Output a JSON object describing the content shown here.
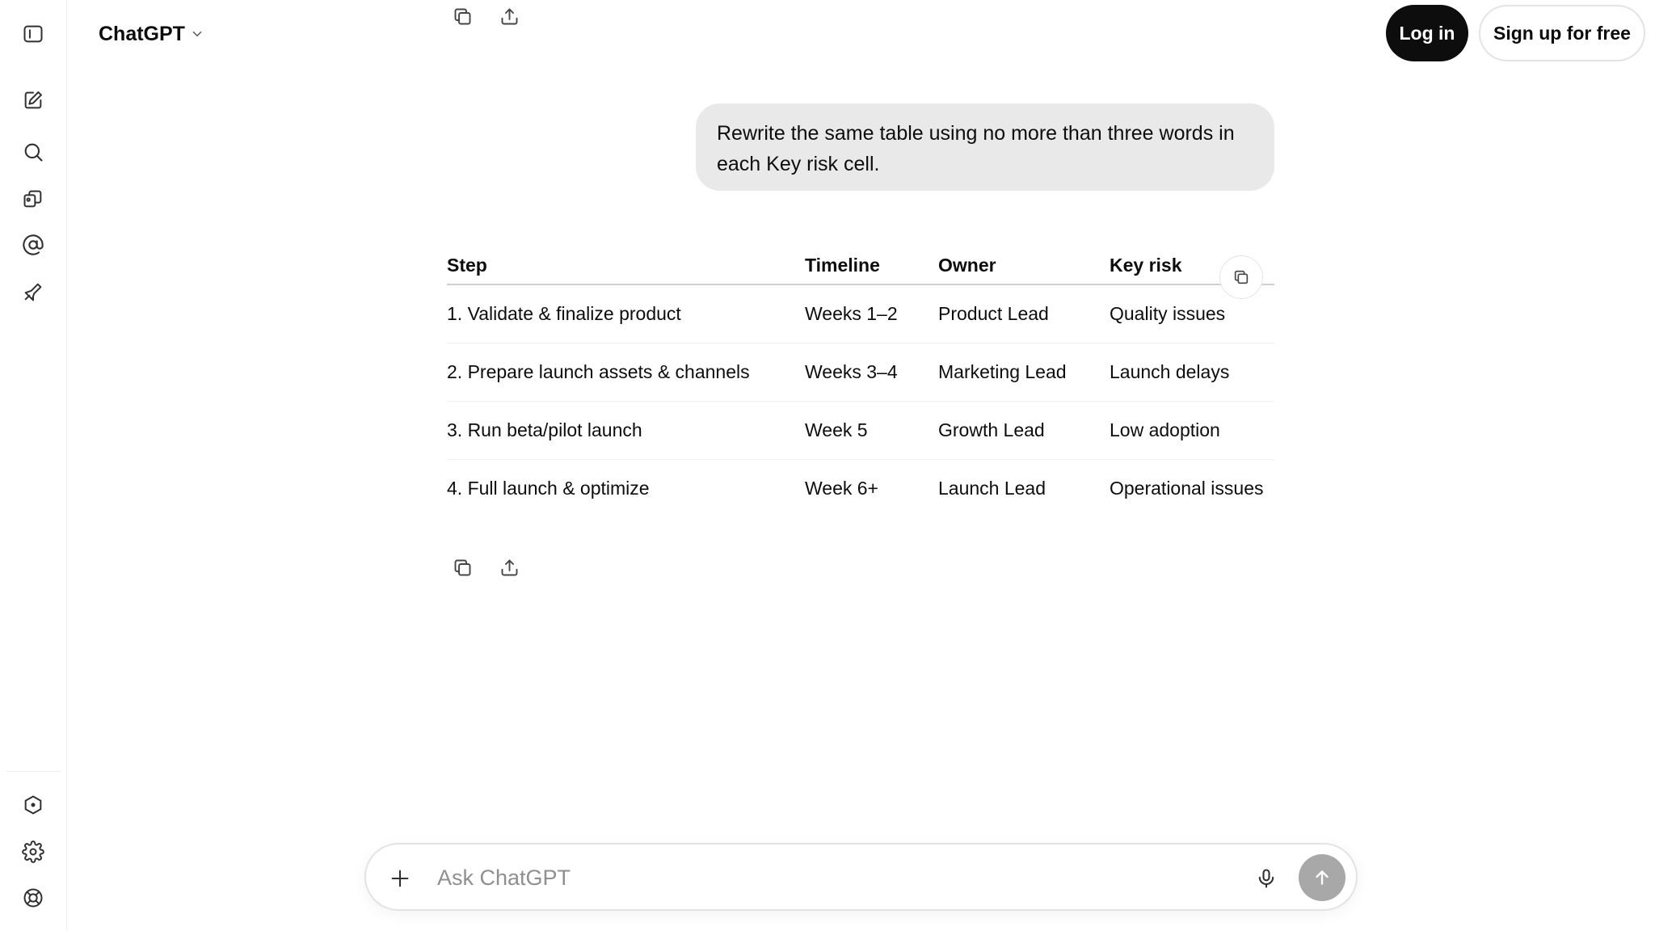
{
  "header": {
    "model_name": "ChatGPT",
    "login_label": "Log in",
    "signup_label": "Sign up for free"
  },
  "sidebar": {
    "icons": [
      "sidebar-toggle-icon",
      "new-chat-icon",
      "search-icon",
      "library-icon",
      "at-sign-icon",
      "explore-icon",
      "plus-hexagon-icon",
      "gear-icon",
      "help-icon"
    ]
  },
  "conversation": {
    "user_message": "Rewrite the same table using no more than three words in each Key risk cell.",
    "table": {
      "headers": [
        "Step",
        "Timeline",
        "Owner",
        "Key risk"
      ],
      "rows": [
        [
          "1. Validate & finalize product",
          "Weeks 1–2",
          "Product Lead",
          "Quality issues"
        ],
        [
          "2. Prepare launch assets & channels",
          "Weeks 3–4",
          "Marketing Lead",
          "Launch delays"
        ],
        [
          "3. Run beta/pilot launch",
          "Week 5",
          "Growth Lead",
          "Low adoption"
        ],
        [
          "4. Full launch & optimize",
          "Week 6+",
          "Launch Lead",
          "Operational issues"
        ]
      ]
    }
  },
  "composer": {
    "placeholder": "Ask ChatGPT",
    "value": ""
  },
  "colors": {
    "primary_button": "#0d0d0d",
    "bubble_bg": "#e9e9e9",
    "send_disabled": "#a8a8a8"
  }
}
